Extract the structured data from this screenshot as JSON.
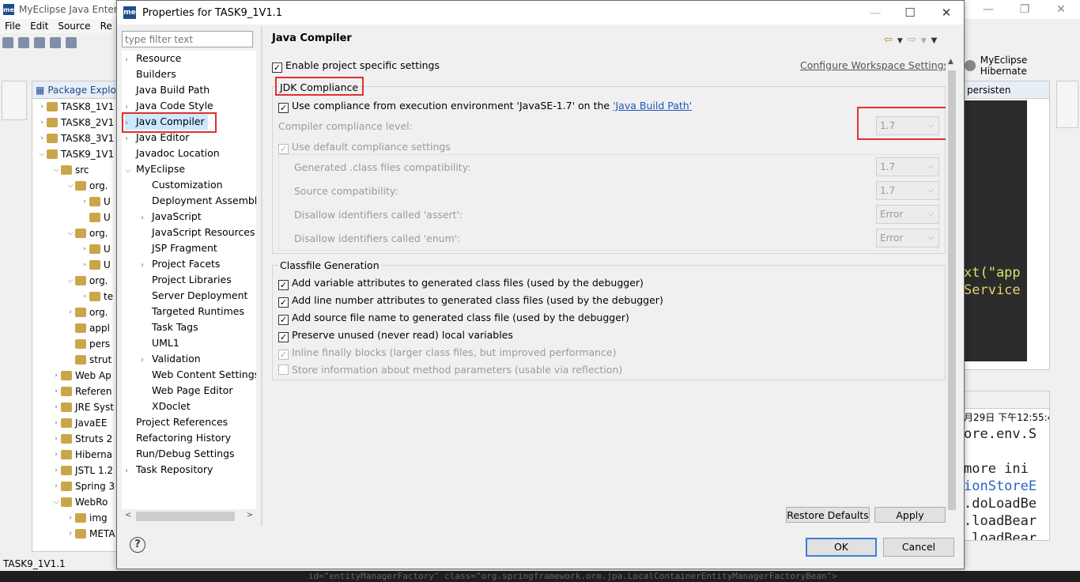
{
  "ide": {
    "title": "MyEclipse Java Enter",
    "menu": [
      "File",
      "Edit",
      "Source",
      "Re"
    ],
    "package_explorer_title": "Package Explor",
    "tree": [
      {
        "label": "TASK8_1V1",
        "arrow": ">",
        "indent": 0
      },
      {
        "label": "TASK8_2V1",
        "arrow": ">",
        "indent": 0
      },
      {
        "label": "TASK8_3V1",
        "arrow": ">",
        "indent": 0
      },
      {
        "label": "TASK9_1V1",
        "arrow": "v",
        "indent": 0
      },
      {
        "label": "src",
        "arrow": "v",
        "indent": 1
      },
      {
        "label": "org.",
        "arrow": "v",
        "indent": 2
      },
      {
        "label": "U",
        "arrow": ">",
        "indent": 3
      },
      {
        "label": "U",
        "arrow": "",
        "indent": 3
      },
      {
        "label": "org.",
        "arrow": "v",
        "indent": 2
      },
      {
        "label": "U",
        "arrow": ">",
        "indent": 3
      },
      {
        "label": "U",
        "arrow": ">",
        "indent": 3
      },
      {
        "label": "org.",
        "arrow": "v",
        "indent": 2
      },
      {
        "label": "te",
        "arrow": ">",
        "indent": 3
      },
      {
        "label": "org.",
        "arrow": ">",
        "indent": 2
      },
      {
        "label": "appl",
        "arrow": "",
        "indent": 2
      },
      {
        "label": "pers",
        "arrow": "",
        "indent": 2
      },
      {
        "label": "strut",
        "arrow": "",
        "indent": 2
      },
      {
        "label": "Web Ap",
        "arrow": ">",
        "indent": 1
      },
      {
        "label": "Referen",
        "arrow": ">",
        "indent": 1
      },
      {
        "label": "JRE Syst",
        "arrow": ">",
        "indent": 1
      },
      {
        "label": "JavaEE",
        "arrow": ">",
        "indent": 1
      },
      {
        "label": "Struts 2",
        "arrow": ">",
        "indent": 1
      },
      {
        "label": "Hiberna",
        "arrow": ">",
        "indent": 1
      },
      {
        "label": "JSTL 1.2",
        "arrow": ">",
        "indent": 1
      },
      {
        "label": "Spring 3",
        "arrow": ">",
        "indent": 1
      },
      {
        "label": "WebRo",
        "arrow": "v",
        "indent": 1
      },
      {
        "label": "img",
        "arrow": ">",
        "indent": 2
      },
      {
        "label": "META",
        "arrow": ">",
        "indent": 2
      }
    ],
    "status": "TASK9_1V1.1",
    "hibernate_label": "MyEclipse Hibernate",
    "editor_tab": "persisten",
    "code_lines": [
      "xt(\"app",
      "Service"
    ],
    "console_date": "月29日 下午12:55:4",
    "console_lines": [
      "ore.env.S",
      "",
      " more ini",
      "ionStoreE",
      ".doLoadBe",
      ".loadBear",
      ".loadBear"
    ],
    "bottom_code": "id=\"entityManagerFactory\" class=\"org.springframework.orm.jpa.LocalContainerEntityManagerFactoryBean\">"
  },
  "dialog": {
    "title": "Properties for TASK9_1V1.1",
    "filter_placeholder": "type filter text",
    "nav": [
      {
        "label": "Resource",
        "arrow": ">",
        "indent": 0
      },
      {
        "label": "Builders",
        "arrow": "",
        "indent": 0
      },
      {
        "label": "Java Build Path",
        "arrow": "",
        "indent": 0
      },
      {
        "label": "Java Code Style",
        "arrow": ">",
        "indent": 0
      },
      {
        "label": "Java Compiler",
        "arrow": ">",
        "indent": 0,
        "selected": true
      },
      {
        "label": "Java Editor",
        "arrow": ">",
        "indent": 0
      },
      {
        "label": "Javadoc Location",
        "arrow": "",
        "indent": 0
      },
      {
        "label": "MyEclipse",
        "arrow": "v",
        "indent": 0
      },
      {
        "label": "Customization",
        "arrow": "",
        "indent": 1
      },
      {
        "label": "Deployment Assembl",
        "arrow": "",
        "indent": 1
      },
      {
        "label": "JavaScript",
        "arrow": ">",
        "indent": 1
      },
      {
        "label": "JavaScript Resources",
        "arrow": "",
        "indent": 1
      },
      {
        "label": "JSP Fragment",
        "arrow": "",
        "indent": 1
      },
      {
        "label": "Project Facets",
        "arrow": ">",
        "indent": 1
      },
      {
        "label": "Project Libraries",
        "arrow": "",
        "indent": 1
      },
      {
        "label": "Server Deployment",
        "arrow": "",
        "indent": 1
      },
      {
        "label": "Targeted Runtimes",
        "arrow": "",
        "indent": 1
      },
      {
        "label": "Task Tags",
        "arrow": "",
        "indent": 1
      },
      {
        "label": "UML1",
        "arrow": "",
        "indent": 1
      },
      {
        "label": "Validation",
        "arrow": ">",
        "indent": 1
      },
      {
        "label": "Web Content Settings",
        "arrow": "",
        "indent": 1
      },
      {
        "label": "Web Page Editor",
        "arrow": "",
        "indent": 1
      },
      {
        "label": "XDoclet",
        "arrow": "",
        "indent": 1
      },
      {
        "label": "Project References",
        "arrow": "",
        "indent": 0
      },
      {
        "label": "Refactoring History",
        "arrow": "",
        "indent": 0
      },
      {
        "label": "Run/Debug Settings",
        "arrow": "",
        "indent": 0
      },
      {
        "label": "Task Repository",
        "arrow": ">",
        "indent": 0
      }
    ],
    "page_title": "Java Compiler",
    "enable_project_specific": "Enable project specific settings",
    "configure_workspace_link": "Configure Workspace Settings...",
    "jdk_group": "JDK Compliance",
    "use_compliance_prefix": "Use compliance from execution environment 'JavaSE-1.7' on the ",
    "use_compliance_link": "'Java Build Path'",
    "compliance_level_label": "Compiler compliance level:",
    "compliance_level_value": "1.7",
    "use_default_compliance": "Use default compliance settings",
    "generated_label": "Generated .class files compatibility:",
    "generated_value": "1.7",
    "source_label": "Source compatibility:",
    "source_value": "1.7",
    "assert_label": "Disallow identifiers called 'assert':",
    "assert_value": "Error",
    "enum_label": "Disallow identifiers called 'enum':",
    "enum_value": "Error",
    "classfile_group": "Classfile Generation",
    "classfile_options": [
      {
        "label": "Add variable attributes to generated class files (used by the debugger)",
        "checked": true,
        "disabled": false
      },
      {
        "label": "Add line number attributes to generated class files (used by the debugger)",
        "checked": true,
        "disabled": false
      },
      {
        "label": "Add source file name to generated class file (used by the debugger)",
        "checked": true,
        "disabled": false
      },
      {
        "label": "Preserve unused (never read) local variables",
        "checked": true,
        "disabled": false
      },
      {
        "label": "Inline finally blocks (larger class files, but improved performance)",
        "checked": true,
        "disabled": true
      },
      {
        "label": "Store information about method parameters (usable via reflection)",
        "checked": false,
        "disabled": true
      }
    ],
    "restore_defaults": "Restore Defaults",
    "apply": "Apply",
    "ok": "OK",
    "cancel": "Cancel",
    "help": "?"
  },
  "colors": {
    "highlight": "#e03030",
    "link": "#1a5ab8",
    "selection": "#cce8ff"
  }
}
